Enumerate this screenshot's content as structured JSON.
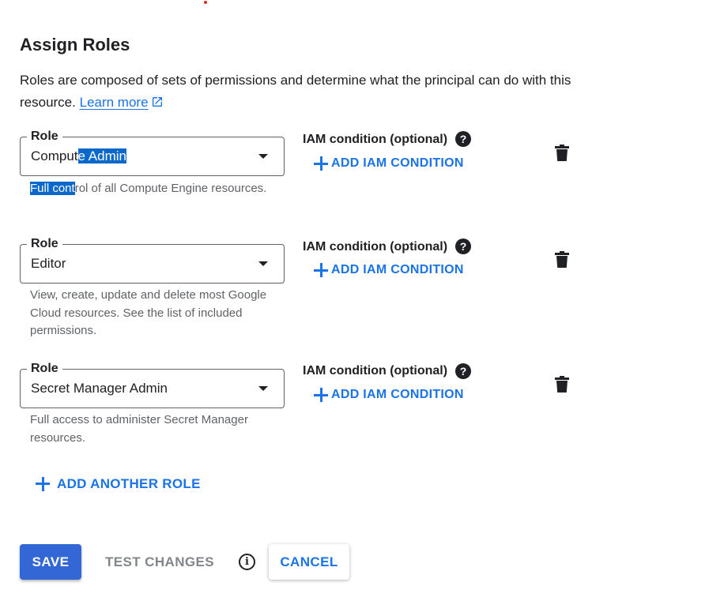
{
  "page": {
    "title": "Assign Roles",
    "description": "Roles are composed of sets of permissions and determine what the principal can do with this resource.",
    "learn_more": "Learn more"
  },
  "roles": [
    {
      "label": "Role",
      "value_pre": "Comput",
      "value_sel": "e Admin ",
      "help_sel": "Full cont",
      "help_rest": "rol of all Compute Engine resources.",
      "iam_label": "IAM condition (optional)",
      "add_condition": "ADD IAM CONDITION"
    },
    {
      "label": "Role",
      "value": "Editor",
      "help": "View, create, update and delete most Google Cloud resources. See the list of included permissions.",
      "iam_label": "IAM condition (optional)",
      "add_condition": "ADD IAM CONDITION"
    },
    {
      "label": "Role",
      "value": "Secret Manager Admin",
      "help": "Full access to administer Secret Manager resources.",
      "iam_label": "IAM condition (optional)",
      "add_condition": "ADD IAM CONDITION"
    }
  ],
  "add_another_role": "ADD ANOTHER ROLE",
  "actions": {
    "save": "SAVE",
    "test_changes": "TEST CHANGES",
    "cancel": "CANCEL"
  },
  "icons": {
    "help": "help-circle-icon",
    "info": "info-icon",
    "delete": "trash-icon",
    "add": "plus-icon",
    "external": "open-in-new-icon",
    "dropdown": "caret-down-icon"
  },
  "colors": {
    "accent": "#1a73e8",
    "primary_button": "#3367d6",
    "selection": "#0b68cb",
    "disabled_text": "#80868b"
  }
}
